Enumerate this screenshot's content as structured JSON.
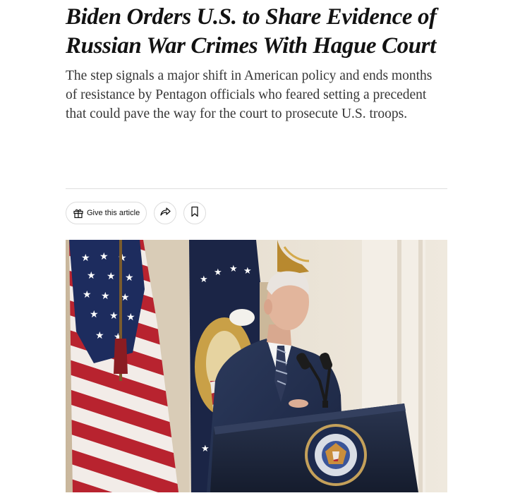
{
  "article": {
    "headline": "Biden Orders U.S. to Share Evidence of Russian War Crimes With Hague Court",
    "summary": "The step signals a major shift in American policy and ends months of resistance by Pentagon officials who feared setting a precedent that could pave the way for the court to prosecute U.S. troops."
  },
  "toolbar": {
    "gift_label": "Give this article",
    "gift_icon": "gift-icon",
    "share_icon": "share-arrow-icon",
    "save_icon": "bookmark-icon"
  },
  "photo": {
    "seal_text": "SEAL OF THE PRESIDENT OF THE UNITED STATES"
  }
}
